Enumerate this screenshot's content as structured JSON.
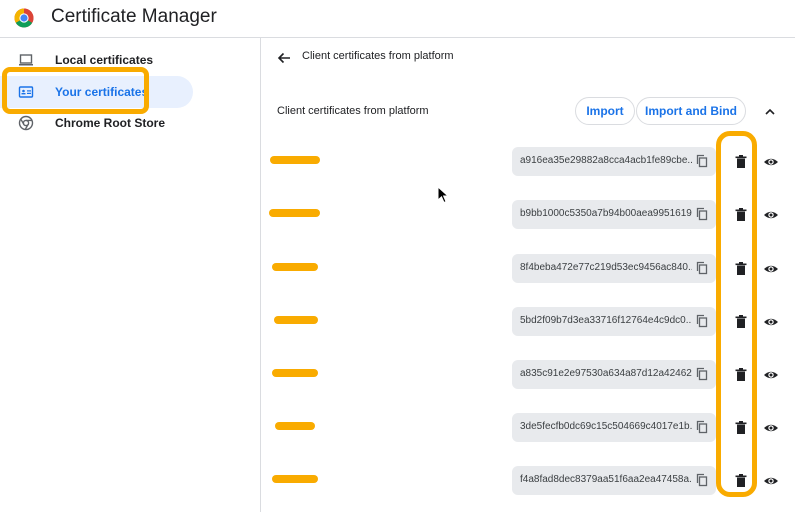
{
  "app": {
    "title": "Certificate Manager",
    "logo": "chrome-logo-icon"
  },
  "sidebar": {
    "items": [
      {
        "label": "Local certificates",
        "icon": "laptop-icon",
        "active": false
      },
      {
        "label": "Your certificates",
        "icon": "id-card-icon",
        "active": true
      },
      {
        "label": "Chrome Root Store",
        "icon": "chrome-icon",
        "active": false
      }
    ]
  },
  "main": {
    "subpage_title": "Client certificates from platform",
    "section_title": "Client certificates from platform",
    "import_label": "Import",
    "import_bind_label": "Import and Bind",
    "certificates": [
      {
        "hash": "a916ea35e29882a8cca4acb1fe89cbe..."
      },
      {
        "hash": "b9bb1000c5350a7b94b00aea9951619..."
      },
      {
        "hash": "8f4beba472e77c219d53ec9456ac840..."
      },
      {
        "hash": "5bd2f09b7d3ea33716f12764e4c9dc0..."
      },
      {
        "hash": "a835c91e2e97530a634a87d12a42462..."
      },
      {
        "hash": "3de5fecfb0dc69c15c504669c4017e1b..."
      },
      {
        "hash": "f4a8fad8dec8379aa51f6aa2ea47458a..."
      }
    ]
  },
  "colors": {
    "accent": "#1a73e8",
    "active_bg": "#e8f0fe",
    "annotation": "#f9ab00",
    "hash_bg": "#e8eaed"
  }
}
